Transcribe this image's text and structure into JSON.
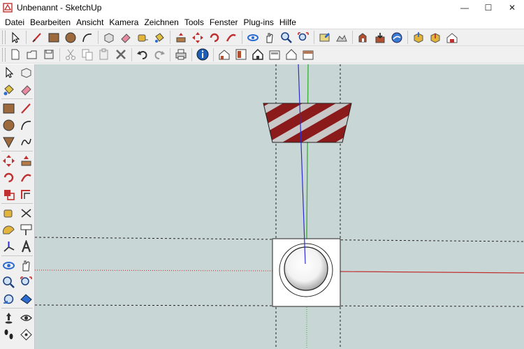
{
  "window": {
    "title": "Unbenannt - SketchUp",
    "minimize": "—",
    "maximize": "☐",
    "close": "✕"
  },
  "menu": [
    "Datei",
    "Bearbeiten",
    "Ansicht",
    "Kamera",
    "Zeichnen",
    "Tools",
    "Fenster",
    "Plug-ins",
    "Hilfe"
  ],
  "toolbar1": [
    "select-icon",
    "line-icon",
    "rectangle-icon",
    "circle-icon",
    "arc-icon",
    "make-component-icon",
    "eraser-icon",
    "tape-measure-icon",
    "paint-bucket-icon",
    "push-pull-icon",
    "move-icon",
    "rotate-icon",
    "follow-me-icon",
    "orbit-icon",
    "pan-icon",
    "zoom-icon",
    "zoom-extents-icon",
    "add-location-icon",
    "toggle-terrain-icon",
    "photo-textures-icon",
    "get-models-icon",
    "share-model-icon",
    "get-components-icon",
    "share-component-icon",
    "extension-warehouse-icon"
  ],
  "toolbar2": [
    "new-icon",
    "open-icon",
    "save-icon",
    "cut-icon",
    "copy-icon",
    "paste-icon",
    "delete-icon",
    "undo-icon",
    "redo-icon",
    "print-icon",
    "model-info-icon",
    "iso-view-icon",
    "top-view-icon",
    "front-view-icon",
    "right-view-icon",
    "back-view-icon",
    "left-view-icon"
  ],
  "colors": {
    "viewport_bg": "#c9d6d6",
    "red_axis": "#c03030",
    "green_axis": "#3cb43c",
    "blue_axis": "#2c2cd0",
    "stripe_red": "#8b1a1a",
    "stripe_light": "#c8c8c8"
  }
}
